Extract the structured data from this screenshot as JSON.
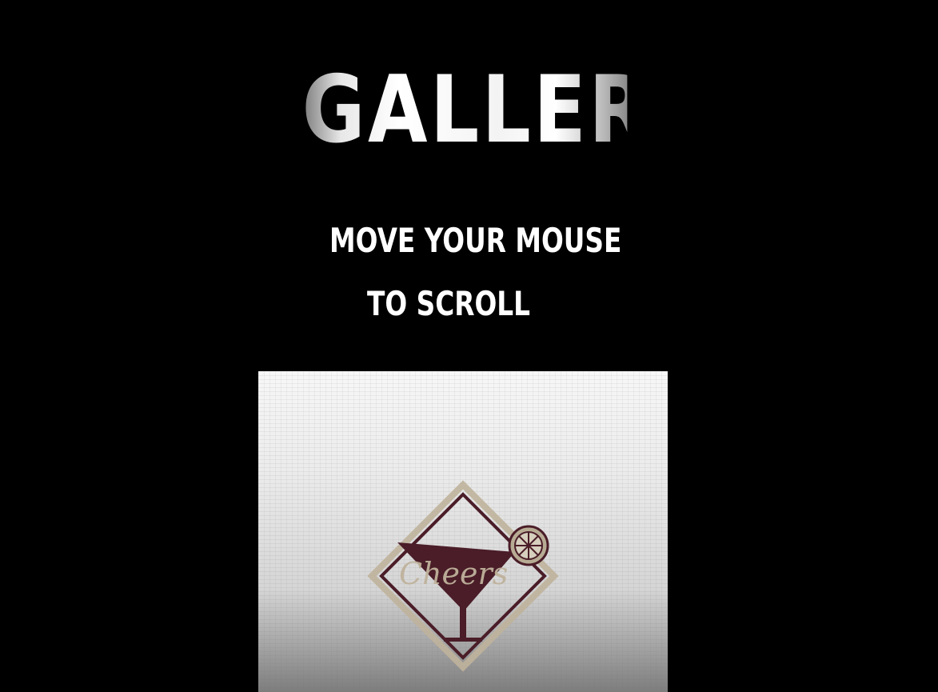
{
  "page": {
    "title": "GALLERY",
    "instruction_line_1": "MOVE YOUR MOUSE",
    "instruction_line_2": "TO SCROLL"
  },
  "gallery": {
    "items": [
      {
        "logo_text": "Cheers",
        "logo_icon": "cocktail-glass-icon"
      }
    ]
  },
  "colors": {
    "background": "#000000",
    "title_text": "#ffffff",
    "logo_burgundy": "#4a1d28",
    "logo_gold": "#bfb29b"
  }
}
